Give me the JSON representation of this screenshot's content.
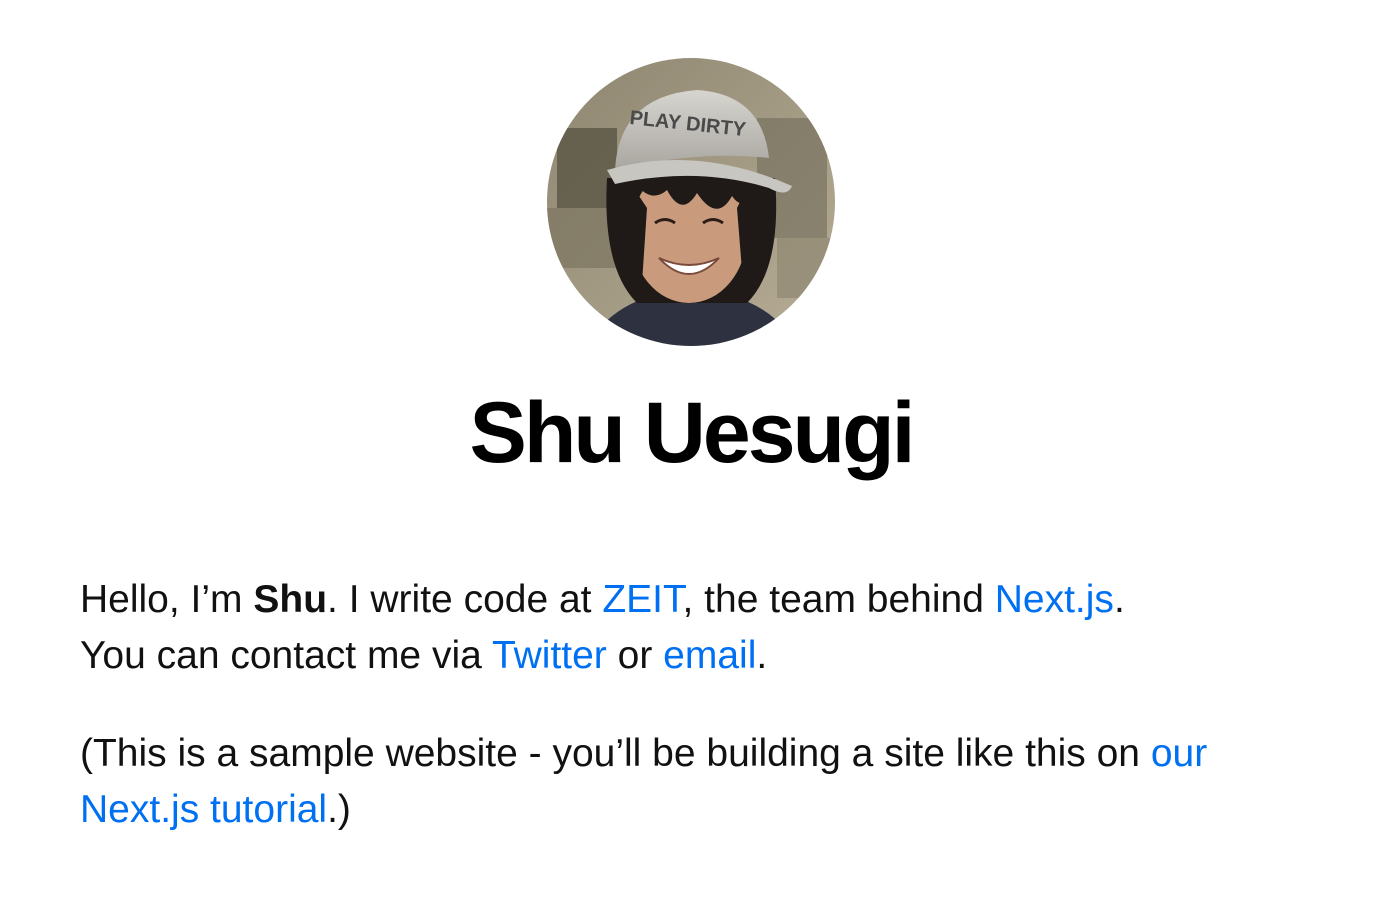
{
  "colors": {
    "link": "#0070f3",
    "text": "#111111",
    "background": "#ffffff"
  },
  "profile": {
    "avatar_icon": "profile-photo",
    "cap_text": "PLAY DIRTY",
    "name": "Shu Uesugi"
  },
  "intro": {
    "greeting": "Hello, I’m ",
    "name_bold": "Shu",
    "text_1": ". I write code at ",
    "link_zeit": "ZEIT",
    "text_2": ", the team behind ",
    "link_nextjs": "Next.js",
    "text_3": ".",
    "line_2": "You can contact me via ",
    "link_twitter": "Twitter",
    "text_or": " or ",
    "link_email": "email",
    "text_end": "."
  },
  "note": {
    "text_1": "(This is a sample website - you’ll be building a site like this on ",
    "link_tutorial": "our Next.js tutorial",
    "text_end": ".)"
  }
}
